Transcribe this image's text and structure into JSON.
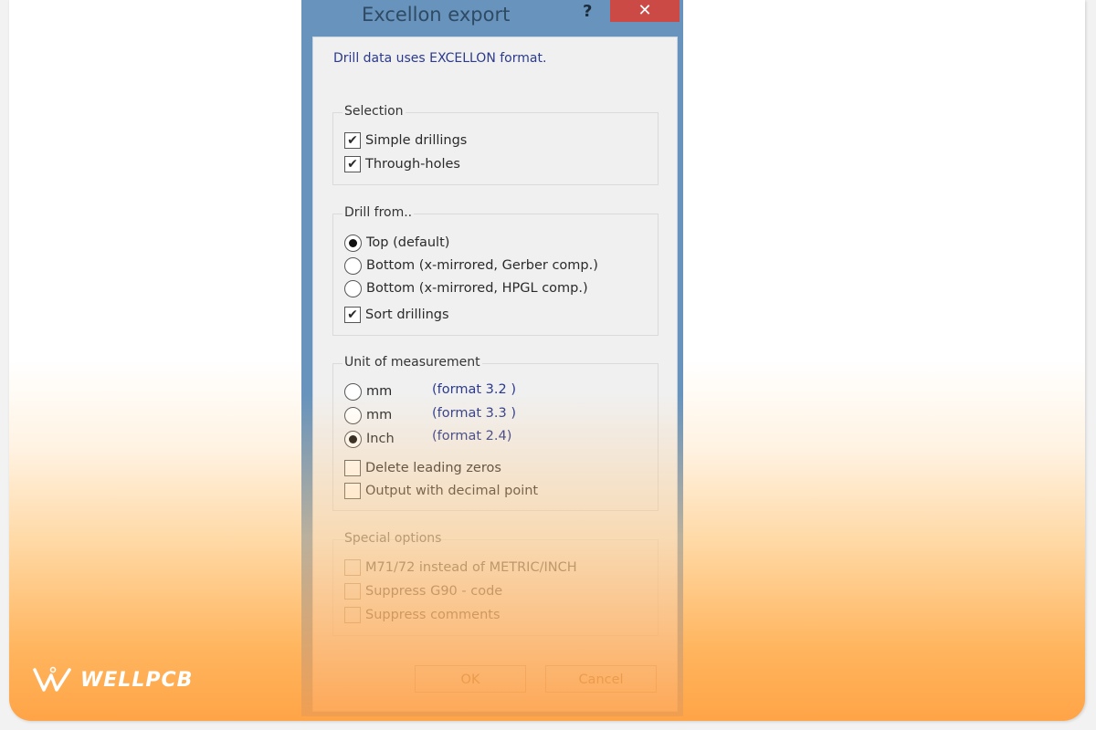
{
  "dialog": {
    "title": "Excellon export",
    "help_label": "?",
    "close_label": "✕",
    "intro": "Drill data uses EXCELLON format.",
    "selection": {
      "legend": "Selection",
      "options": [
        {
          "label": "Simple drillings",
          "checked": true
        },
        {
          "label": "Through-holes",
          "checked": true
        }
      ]
    },
    "drill_from": {
      "legend": "Drill from..",
      "radios": [
        {
          "label": "Top (default)",
          "selected": true
        },
        {
          "label": "Bottom (x-mirrored, Gerber comp.)",
          "selected": false
        },
        {
          "label": "Bottom (x-mirrored, HPGL comp.)",
          "selected": false
        }
      ],
      "sort": {
        "label": "Sort drillings",
        "checked": true
      }
    },
    "unit": {
      "legend": "Unit of measurement",
      "radios": [
        {
          "label": "mm",
          "format": "(format 3.2 )",
          "selected": false
        },
        {
          "label": "mm",
          "format": "(format 3.3 )",
          "selected": false
        },
        {
          "label": "Inch",
          "format": "(format 2.4)",
          "selected": true
        }
      ],
      "checks": [
        {
          "label": "Delete leading zeros",
          "checked": false
        },
        {
          "label": "Output with decimal point",
          "checked": false
        }
      ]
    },
    "special": {
      "legend": "Special options",
      "checks": [
        {
          "label": "M71/72 instead of METRIC/INCH",
          "checked": false
        },
        {
          "label": "Suppress G90 - code",
          "checked": false
        },
        {
          "label": "Suppress comments",
          "checked": false
        }
      ]
    },
    "ok_label": "OK",
    "cancel_label": "Cancel"
  },
  "watermark": {
    "text": "WELLPCB",
    "icon": "wellpcb-logo-icon"
  },
  "checkmark": "✔"
}
